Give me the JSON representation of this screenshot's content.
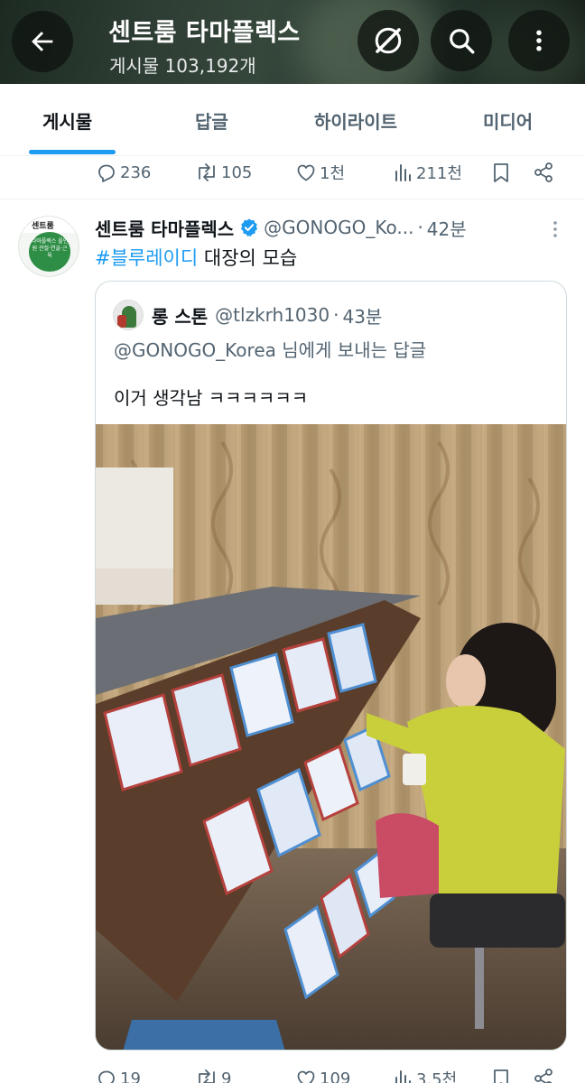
{
  "header": {
    "title": "센트룸 타마플렉스",
    "post_count": "게시물 103,192개",
    "icons": [
      "back-arrow-icon",
      "grok-icon",
      "search-icon",
      "more-vertical-icon"
    ]
  },
  "tabs": [
    {
      "label": "게시물",
      "active": true
    },
    {
      "label": "답글",
      "active": false
    },
    {
      "label": "하이라이트",
      "active": false
    },
    {
      "label": "미디어",
      "active": false
    }
  ],
  "prev_post_actions": {
    "replies": "236",
    "reposts": "105",
    "likes": "1천",
    "views": "211천"
  },
  "tweet": {
    "author": "센트룸 타마플렉스",
    "handle": "@GONOGO_Ko...",
    "time": "42분",
    "hashtag": "#블루레이디",
    "text": " 대장의 모습",
    "avatar_text_top": "센트룸",
    "avatar_text_badge": "타마플렉스 올인원 관절·연골·근육",
    "quote": {
      "author": "롱 스톤",
      "handle": "@tlzkrh1030",
      "time": "43분",
      "reply_to": "@GONOGO_Korea 님에게 보내는 답글",
      "text": "이거 생각남 ㅋㅋㅋㅋㅋㅋ"
    },
    "actions": {
      "replies": "19",
      "reposts": "9",
      "likes": "109",
      "views": "3.5천"
    }
  },
  "colors": {
    "accent": "#1d9bf0",
    "text_primary": "#0f1419",
    "text_secondary": "#536471",
    "verified": "#1d9bf0"
  }
}
